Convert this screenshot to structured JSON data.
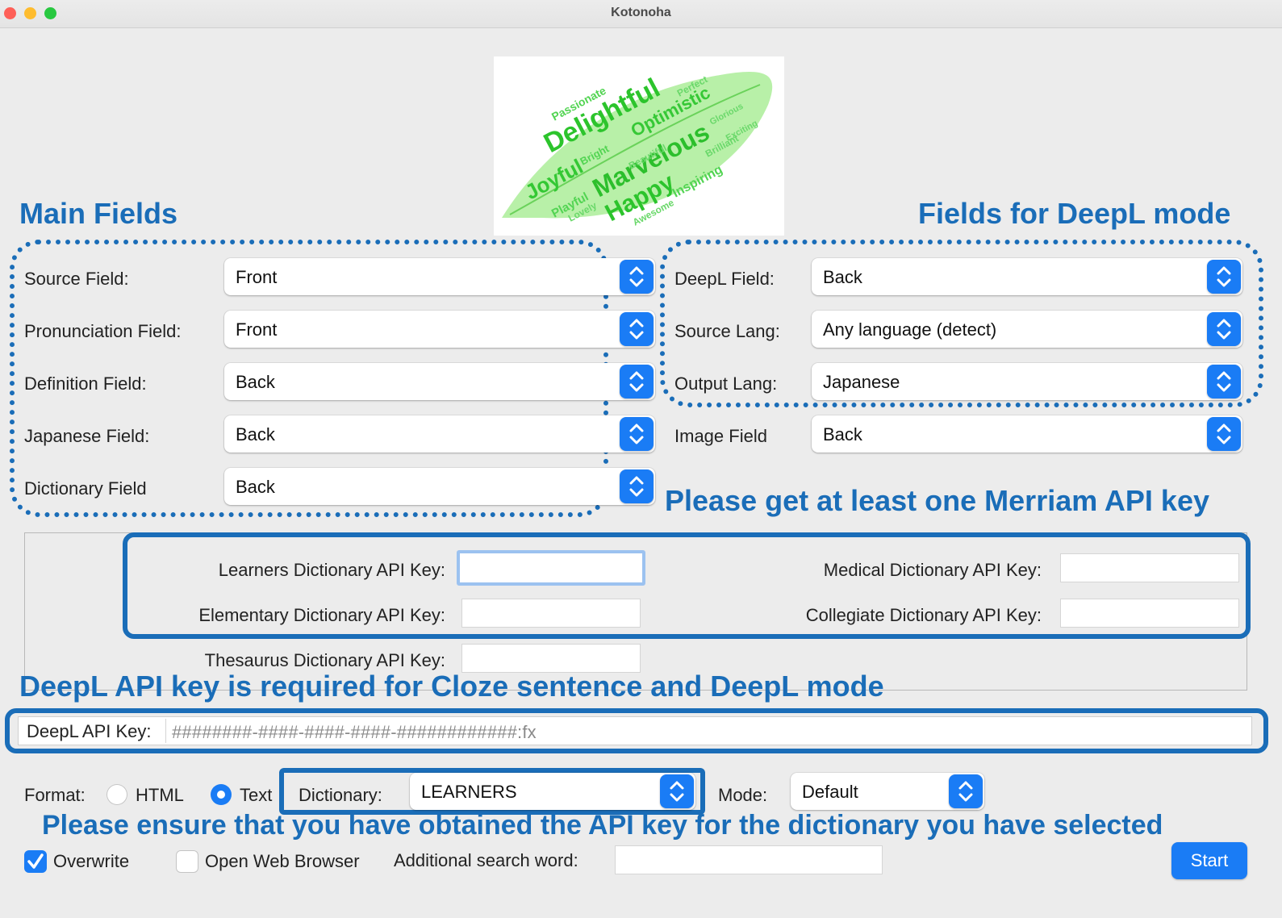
{
  "window": {
    "title": "Kotonoha",
    "colors": {
      "close": "#fe5f57",
      "minimize": "#febc2e",
      "zoom": "#28c840",
      "accent": "#1a7cf5",
      "annotation": "#1a6db8"
    }
  },
  "logo": {
    "words": [
      "Delightful",
      "Optimistic",
      "Marvelous",
      "Joyful",
      "Happy",
      "Bright",
      "Playful",
      "Inspiring",
      "Lovely",
      "Awesome",
      "Passionate",
      "Beautiful",
      "Perfect",
      "Glorious",
      "Brilliant",
      "Exciting"
    ]
  },
  "annotations": {
    "main_fields": "Main Fields",
    "deepl_fields": "Fields for DeepL mode",
    "merriam_key": "Please get at least one Merriam API key",
    "deepl_key_required": "DeepL API key is required for Cloze sentence and DeepL mode",
    "ensure_key": "Please ensure that you have obtained the API key for the dictionary you have selected"
  },
  "main_fields": [
    {
      "label": "Source Field:",
      "value": "Front"
    },
    {
      "label": "Pronunciation Field:",
      "value": "Front"
    },
    {
      "label": "Definition Field:",
      "value": "Back"
    },
    {
      "label": "Japanese Field:",
      "value": "Back"
    },
    {
      "label": "Dictionary Field",
      "value": "Back"
    }
  ],
  "deepl_fields": [
    {
      "label": "DeepL Field:",
      "value": "Back"
    },
    {
      "label": "Source Lang:",
      "value": "Any language (detect)"
    },
    {
      "label": "Output Lang:",
      "value": "Japanese"
    },
    {
      "label": "Image Field",
      "value": "Back"
    }
  ],
  "api_keys": {
    "learners": {
      "label": "Learners Dictionary API Key:",
      "value": ""
    },
    "elementary": {
      "label": "Elementary Dictionary API Key:",
      "value": ""
    },
    "thesaurus": {
      "label": "Thesaurus Dictionary API Key:",
      "value": ""
    },
    "medical": {
      "label": "Medical Dictionary API Key:",
      "value": ""
    },
    "collegiate": {
      "label": "Collegiate Dictionary API Key:",
      "value": ""
    }
  },
  "deepl_key": {
    "label": "DeepL API Key:",
    "placeholder": "########-####-####-####-############:fx"
  },
  "options": {
    "format_label": "Format:",
    "format_html": "HTML",
    "format_text": "Text",
    "format_selected": "Text",
    "dictionary_label": "Dictionary:",
    "dictionary_value": "LEARNERS",
    "mode_label": "Mode:",
    "mode_value": "Default",
    "overwrite_label": "Overwrite",
    "overwrite_checked": true,
    "open_browser_label": "Open Web Browser",
    "open_browser_checked": false,
    "additional_label": "Additional search word:",
    "additional_value": "",
    "start_label": "Start"
  }
}
